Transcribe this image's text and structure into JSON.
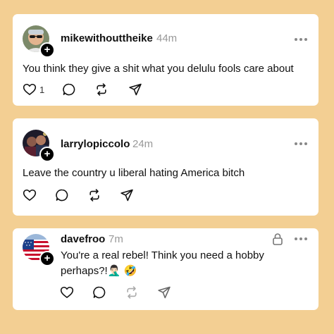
{
  "posts": [
    {
      "username": "mikewithouttheike",
      "time": "44m",
      "text": "You think they give a shit what you delulu fools care about",
      "like_count": "1",
      "locked": false
    },
    {
      "username": "larrylopiccolo",
      "time": "24m",
      "text": "Leave the country u liberal hating America bitch",
      "like_count": "",
      "locked": false
    },
    {
      "username": "davefroo",
      "time": "7m",
      "text_line1": "You're a real rebel! Think you need a hobby",
      "text_line2": "perhaps?!🤦🏻‍♂️ 🤣",
      "like_count": "",
      "locked": true,
      "repost_disabled": true
    }
  ],
  "icons": {
    "like": "heart-icon",
    "comment": "comment-icon",
    "repost": "repost-icon",
    "share": "send-icon",
    "more": "more-dots-icon",
    "follow": "plus-icon",
    "lock": "lock-icon"
  },
  "colors": {
    "background": "#f3cf93",
    "card": "#ffffff",
    "text": "#101010",
    "muted": "#999999"
  }
}
